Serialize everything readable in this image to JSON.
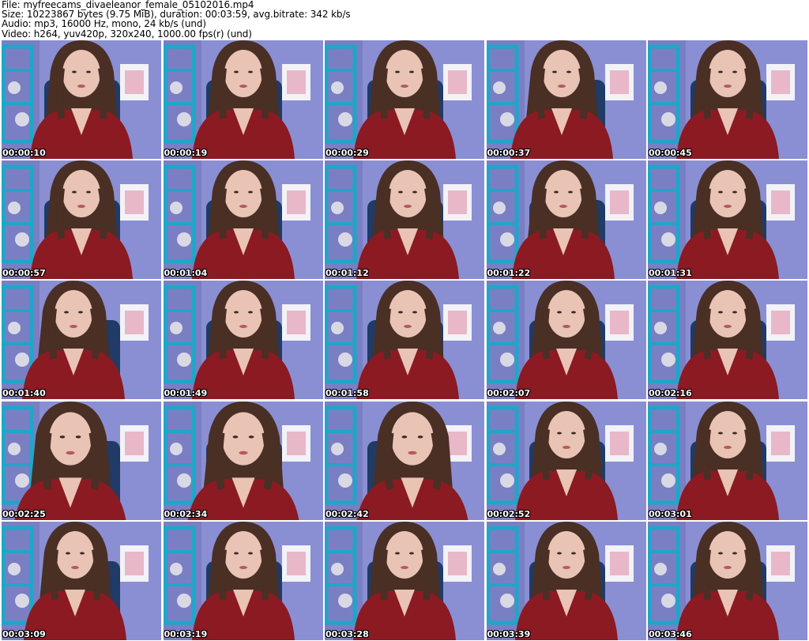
{
  "header": {
    "file": "File: myfreecams_divaeleanor_female_05102016.mp4",
    "size": "Size: 10223867 bytes (9.75 MiB), duration: 00:03:59, avg.bitrate: 342 kb/s",
    "audio": "Audio: mp3, 16000 Hz, mono, 24 kb/s (und)",
    "video": "Video: h264, yuv420p, 320x240, 1000.00 fps(r) (und)"
  },
  "colors": {
    "wall": "#8a8fd3",
    "shelf": "#1fa6c9",
    "shirt": "#8b1a22",
    "hair": "#4a2f25",
    "skin": "#e9c3b4",
    "chair": "#1f3b66"
  },
  "thumbnails": [
    {
      "time": "00:00:10"
    },
    {
      "time": "00:00:19"
    },
    {
      "time": "00:00:29"
    },
    {
      "time": "00:00:37"
    },
    {
      "time": "00:00:45"
    },
    {
      "time": "00:00:57"
    },
    {
      "time": "00:01:04"
    },
    {
      "time": "00:01:12"
    },
    {
      "time": "00:01:22"
    },
    {
      "time": "00:01:31"
    },
    {
      "time": "00:01:40"
    },
    {
      "time": "00:01:49"
    },
    {
      "time": "00:01:58"
    },
    {
      "time": "00:02:07"
    },
    {
      "time": "00:02:16"
    },
    {
      "time": "00:02:25"
    },
    {
      "time": "00:02:34"
    },
    {
      "time": "00:02:42"
    },
    {
      "time": "00:02:52"
    },
    {
      "time": "00:03:01"
    },
    {
      "time": "00:03:09"
    },
    {
      "time": "00:03:19"
    },
    {
      "time": "00:03:28"
    },
    {
      "time": "00:03:39"
    },
    {
      "time": "00:03:46"
    }
  ]
}
